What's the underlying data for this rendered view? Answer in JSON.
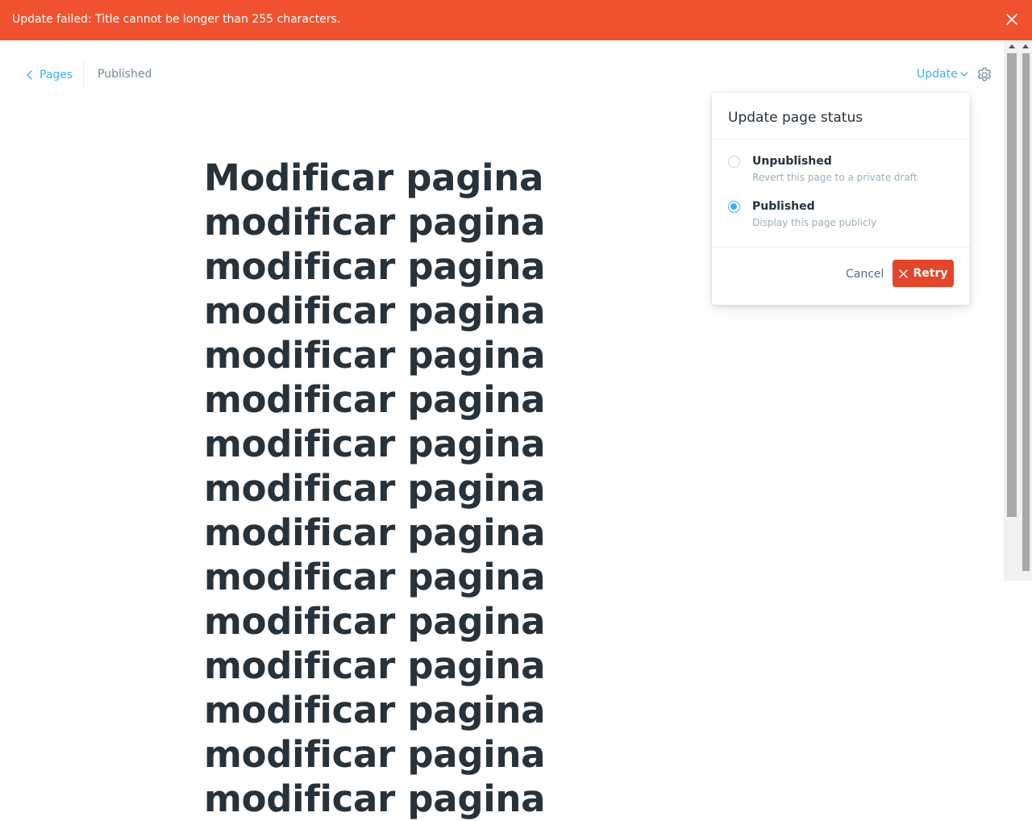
{
  "alert": {
    "message": "Update failed: Title cannot be longer than 255 characters.",
    "close_icon": "close-icon",
    "color": "#f05230"
  },
  "header": {
    "back_label": "Pages",
    "status": "Published",
    "update_label": "Update",
    "settings_icon": "gear-icon",
    "accent_color": "#3eb0ef"
  },
  "editor": {
    "title": "Modificar pagina modificar pagina modificar pagina modificar pagina modificar pagina modificar pagina modificar pagina modificar pagina modificar pagina modificar pagina modificar pagina modificar pagina modificar pagina modificar pagina modificar pagina"
  },
  "status_panel": {
    "title": "Update page status",
    "options": [
      {
        "label": "Unpublished",
        "description": "Revert this page to a private draft",
        "selected": false
      },
      {
        "label": "Published",
        "description": "Display this page publicly",
        "selected": true
      }
    ],
    "cancel_label": "Cancel",
    "retry_label": "Retry",
    "retry_color": "#e4462b"
  }
}
